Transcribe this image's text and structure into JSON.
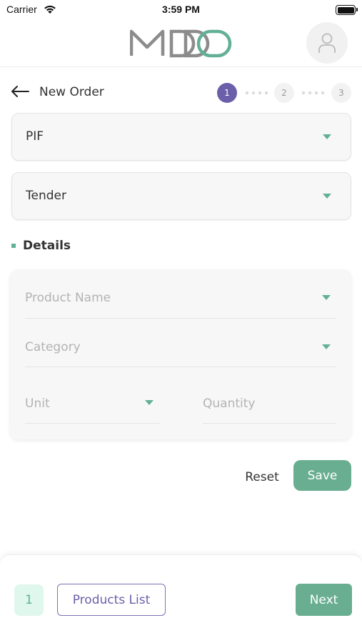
{
  "status_bar": {
    "carrier": "Carrier",
    "time": "3:59 PM"
  },
  "header": {
    "logo_icon": "mddo-logo",
    "profile_icon": "user-icon"
  },
  "order": {
    "title": "New Order",
    "steps": [
      "1",
      "2",
      "3"
    ],
    "active_step": 1
  },
  "selects": {
    "first_value": "PIF",
    "second_value": "Tender"
  },
  "details": {
    "title": "Details",
    "product_name_placeholder": "Product Name",
    "category_placeholder": "Category",
    "unit_placeholder": "Unit",
    "quantity_placeholder": "Quantity"
  },
  "actions": {
    "reset_label": "Reset",
    "save_label": "Save"
  },
  "bottom_bar": {
    "count": "1",
    "products_list_label": "Products List",
    "next_label": "Next"
  },
  "colors": {
    "accent_green": "#69ae91",
    "accent_purple": "#6a5fa8",
    "badge_bg": "#dff7ec"
  }
}
